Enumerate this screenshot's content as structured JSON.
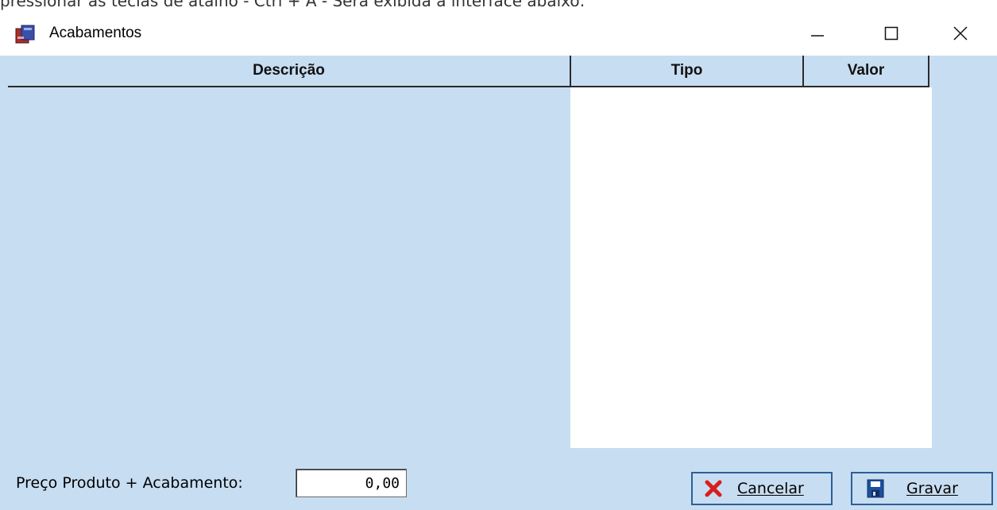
{
  "doc_text": "pressionar as teclas de atalho - Ctrl + A - Será exibida a interface abaixo:",
  "window": {
    "title": "Acabamentos",
    "minimize_glyph": "—",
    "maximize_glyph": "☐",
    "close_glyph": "✕"
  },
  "grid": {
    "columns": [
      "Descrição",
      "Tipo",
      "Valor"
    ],
    "rows": []
  },
  "footer": {
    "price_label": "Preço Produto + Acabamento:",
    "price_value": "0,00"
  },
  "buttons": {
    "cancel_label": "Cancelar",
    "save_label": "Gravar"
  },
  "colors": {
    "client_bg": "#c7ddf2",
    "button_border": "#2d5f98",
    "cancel_icon": "#d81e1e",
    "save_icon": "#1e4f9c"
  }
}
